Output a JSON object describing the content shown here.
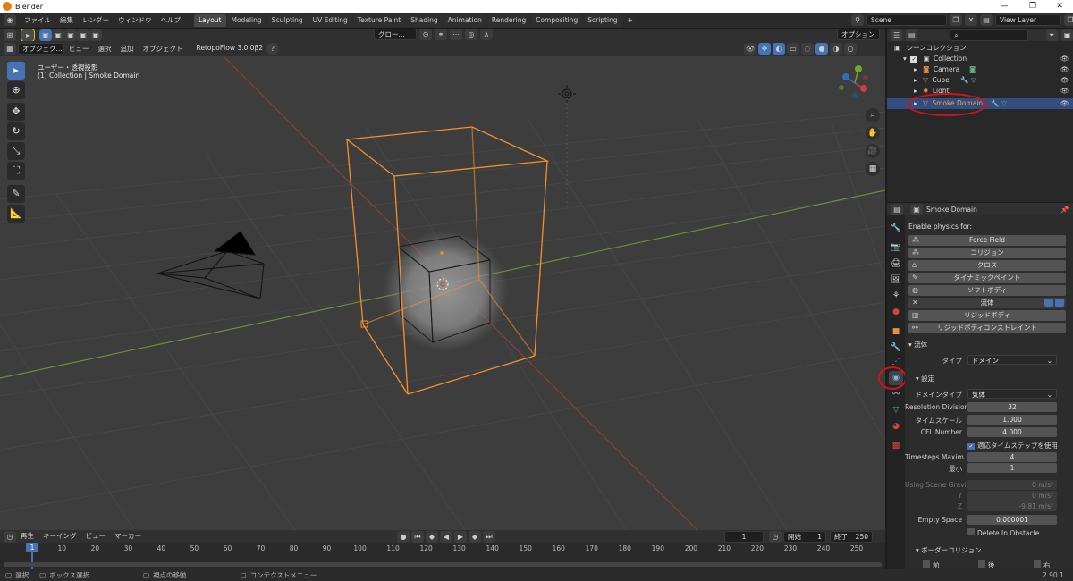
{
  "titlebar": {
    "title": "Blender",
    "min": "—",
    "max": "❐",
    "close": "✕"
  },
  "menu": [
    "ファイル",
    "編集",
    "レンダー",
    "ウィンドウ",
    "ヘルプ"
  ],
  "workspaces": [
    "Layout",
    "Modeling",
    "Sculpting",
    "UV Editing",
    "Texture Paint",
    "Shading",
    "Animation",
    "Rendering",
    "Compositing",
    "Scripting"
  ],
  "workspace_add": "+",
  "scene": {
    "label": "Scene",
    "view_layer": "View Layer"
  },
  "vp_header": {
    "mode": "オブジェク...",
    "menus": [
      "ビュー",
      "選択",
      "追加",
      "オブジェクト"
    ],
    "addon": "RetopoFlow 3.0.0β2",
    "transform_orientation": "グロー...",
    "options": "オプション"
  },
  "viewport": {
    "view_name": "ユーザー・透視投影",
    "collection_info": "(1) Collection | Smoke Domain"
  },
  "timeline": {
    "menus": [
      "再生",
      "キーイング",
      "ビュー",
      "マーカー"
    ],
    "current_frame": "1",
    "start_label": "開始",
    "start": "1",
    "end_label": "終了",
    "end": "250",
    "ticks": [
      "1",
      "10",
      "20",
      "30",
      "40",
      "50",
      "60",
      "70",
      "80",
      "90",
      "100",
      "110",
      "120",
      "130",
      "140",
      "150",
      "160",
      "170",
      "180",
      "190",
      "200",
      "210",
      "220",
      "230",
      "240",
      "250"
    ],
    "playhead": "1"
  },
  "statusbar": {
    "items": [
      "選択",
      "ボックス選択",
      "視点の移動",
      "コンテクストメニュー"
    ],
    "version": "2.90.1"
  },
  "outliner": {
    "root": "シーンコレクション",
    "items": [
      {
        "name": "Collection",
        "level": 1
      },
      {
        "name": "Camera",
        "level": 2
      },
      {
        "name": "Cube",
        "level": 2
      },
      {
        "name": "Light",
        "level": 2
      },
      {
        "name": "Smoke Domain",
        "level": 2,
        "selected": true
      }
    ]
  },
  "properties": {
    "object_name": "Smoke Domain",
    "enable_physics": "Enable physics for:",
    "physics_buttons": [
      {
        "label": "Force Field",
        "icon": "force-field-icon"
      },
      {
        "label": "コリジョン",
        "icon": "collision-icon"
      },
      {
        "label": "クロス",
        "icon": "cloth-icon"
      },
      {
        "label": "ダイナミックペイント",
        "icon": "dynamic-paint-icon"
      },
      {
        "label": "ソフトボディ",
        "icon": "soft-body-icon"
      },
      {
        "label": "流体",
        "icon": "fluid-icon",
        "close": "✕"
      },
      {
        "label": "リジッドボディ",
        "icon": "rigid-body-icon"
      },
      {
        "label": "リジッドボディコンストレイント",
        "icon": "rigid-constraint-icon"
      }
    ],
    "fluid_section": "流体",
    "type_label": "タイプ",
    "type_value": "ドメイン",
    "settings_section": "設定",
    "domain_type_label": "ドメインタイプ",
    "domain_type_value": "気体",
    "rows": [
      {
        "label": "Resolution Division",
        "value": "32"
      },
      {
        "label": "タイムスケール",
        "value": "1.000"
      },
      {
        "label": "CFL Number",
        "value": "4.000"
      }
    ],
    "adaptive_timestep": "適応タイムステップを使用",
    "timesteps_max_label": "Timesteps Maxim...",
    "timesteps_max": "4",
    "min_label": "最小",
    "min_value": "1",
    "gravity_label": "Using Scene Gravi...",
    "gravity_x": "0 m/s²",
    "y_label": "Y",
    "gravity_y": "0 m/s²",
    "z_label": "Z",
    "gravity_z": "-9.81 m/s²",
    "empty_space_label": "Empty Space",
    "empty_space": "0.000001",
    "delete_obstacle": "Delete In Obstacle",
    "border_section": "ボーダーコリジョン",
    "border_items": [
      "前",
      "後",
      "右"
    ]
  },
  "colors": {
    "accent": "#4772b3",
    "selection": "#e8a33d",
    "highlight": "#d0121b"
  }
}
